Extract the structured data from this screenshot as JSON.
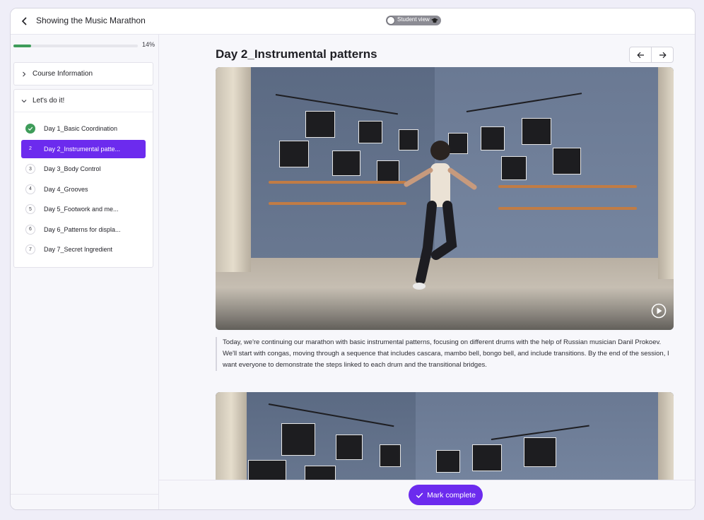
{
  "header": {
    "course_title": "Showing the Music Marathon",
    "student_view_label": "Student view"
  },
  "progress": {
    "percent_label": "14%",
    "value": 0.14
  },
  "sidebar": {
    "sections": [
      {
        "label": "Course Information",
        "expanded": false
      },
      {
        "label": "Let's do it!",
        "expanded": true
      }
    ],
    "lessons": [
      {
        "num": "1",
        "label": "Day 1_Basic Coordination",
        "status": "complete"
      },
      {
        "num": "2",
        "label": "Day 2_Instrumental patte...",
        "status": "active"
      },
      {
        "num": "3",
        "label": "Day 3_Body Control",
        "status": "pending"
      },
      {
        "num": "4",
        "label": "Day 4_Grooves",
        "status": "pending"
      },
      {
        "num": "5",
        "label": "Day 5_Footwork and me...",
        "status": "pending"
      },
      {
        "num": "6",
        "label": "Day 6_Patterns for displa...",
        "status": "pending"
      },
      {
        "num": "7",
        "label": "Day 7_Secret Ingredient",
        "status": "pending"
      }
    ]
  },
  "main": {
    "lesson_title": "Day 2_Instrumental patterns",
    "description": "Today, we're continuing our marathon with basic instrumental patterns, focusing on different drums with the help of Russian musician Danil Prokoev. We'll start with congas, moving through a sequence that includes cascara, mambo bell, bongo bell, and include transitions. By the end of the session, I want everyone to demonstrate the steps linked to each drum and the transitional bridges."
  },
  "footer": {
    "mark_complete_label": "Mark complete"
  },
  "colors": {
    "accent": "#6c2bee",
    "success": "#3f9c5a"
  },
  "icons": [
    "back-arrow-icon",
    "graduation-cap-icon",
    "chevron-right-icon",
    "chevron-down-icon",
    "check-icon",
    "arrow-left-icon",
    "arrow-right-icon",
    "play-icon"
  ]
}
